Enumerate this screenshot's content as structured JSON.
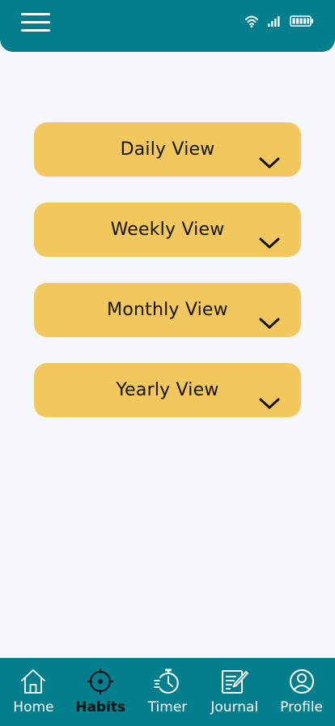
{
  "header": {
    "menu_icon": "hamburger-menu-icon",
    "status_icons": [
      "wifi-icon",
      "signal-icon",
      "battery-icon"
    ]
  },
  "views": [
    {
      "label": "Daily View",
      "icon": "chevron-down-icon"
    },
    {
      "label": "Weekly View",
      "icon": "chevron-down-icon"
    },
    {
      "label": "Monthly View",
      "icon": "chevron-down-icon"
    },
    {
      "label": "Yearly View",
      "icon": "chevron-down-icon"
    }
  ],
  "nav": {
    "items": [
      {
        "label": "Home",
        "icon": "home-icon",
        "active": false
      },
      {
        "label": "Habits",
        "icon": "target-icon",
        "active": true
      },
      {
        "label": "Timer",
        "icon": "stopwatch-icon",
        "active": false
      },
      {
        "label": "Journal",
        "icon": "journal-edit-icon",
        "active": false
      },
      {
        "label": "Profile",
        "icon": "profile-icon",
        "active": false
      }
    ]
  },
  "colors": {
    "primary": "#037e8c",
    "accent": "#f2c75d",
    "background": "#f6f7fc"
  }
}
